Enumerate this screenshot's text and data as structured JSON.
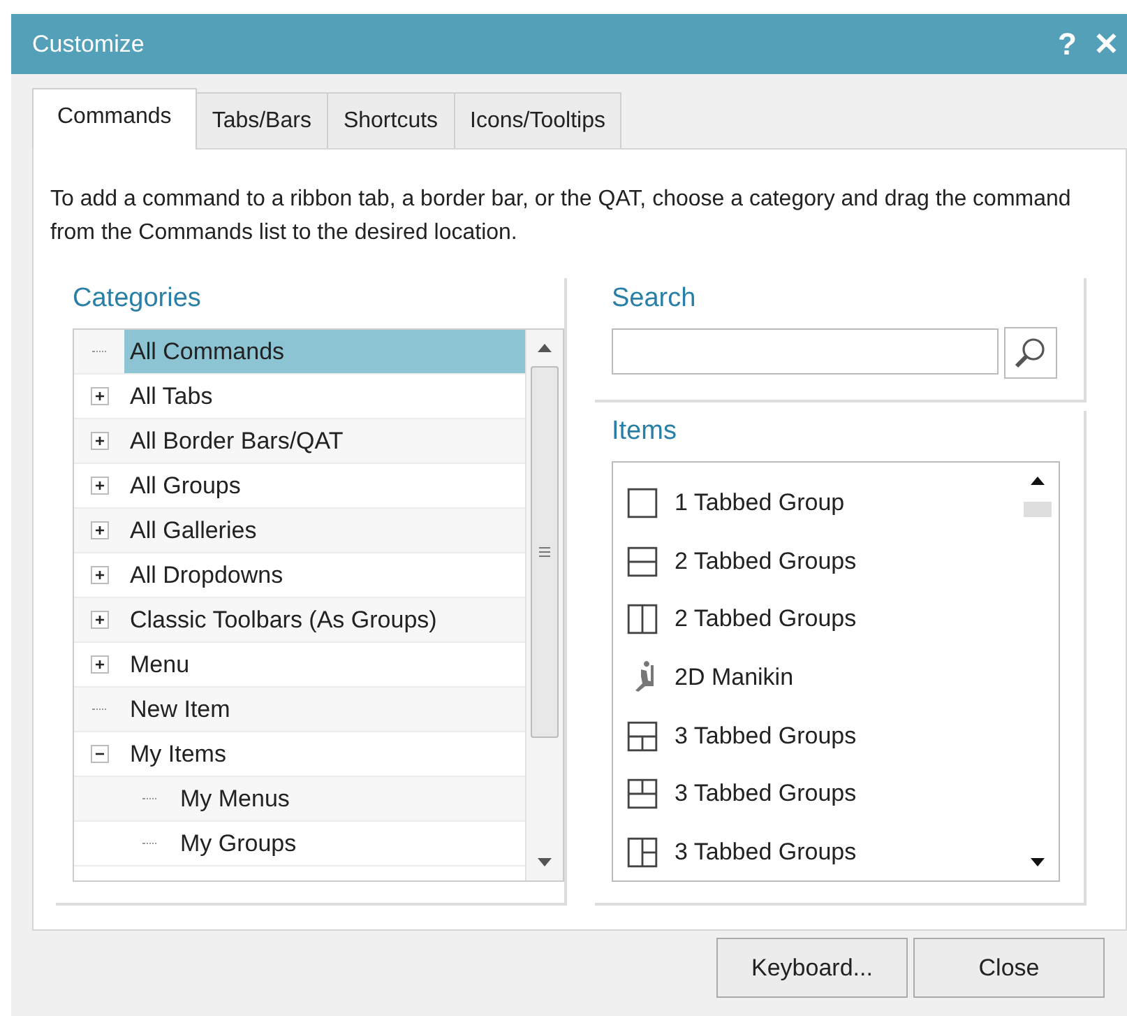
{
  "window": {
    "title": "Customize",
    "help": "?",
    "close": "✕"
  },
  "tabs": [
    {
      "label": "Commands",
      "selected": true
    },
    {
      "label": "Tabs/Bars",
      "selected": false
    },
    {
      "label": "Shortcuts",
      "selected": false
    },
    {
      "label": "Icons/Tooltips",
      "selected": false
    }
  ],
  "description": "To add a command to a ribbon tab, a border bar, or the QAT, choose a category and drag the command from the Commands list to the desired location.",
  "categories": {
    "title": "Categories",
    "items": [
      {
        "label": "All Commands",
        "selected": true
      },
      {
        "label": "All Tabs",
        "selected": false,
        "expanded": false
      },
      {
        "label": "All Border Bars/QAT",
        "selected": false,
        "expanded": false
      },
      {
        "label": "All Groups",
        "selected": false,
        "expanded": false
      },
      {
        "label": "All Galleries",
        "selected": false,
        "expanded": false
      },
      {
        "label": "All Dropdowns",
        "selected": false,
        "expanded": false
      },
      {
        "label": "Classic Toolbars (As Groups)",
        "selected": false,
        "expanded": false
      },
      {
        "label": "Menu",
        "selected": false,
        "expanded": false
      },
      {
        "label": "New Item",
        "selected": false
      },
      {
        "label": "My Items",
        "selected": false,
        "expanded": true,
        "children": [
          {
            "label": "My Menus",
            "selected": false
          },
          {
            "label": "My Groups",
            "selected": false
          }
        ]
      }
    ]
  },
  "search": {
    "title": "Search"
  },
  "items": {
    "title": "Items",
    "list": [
      {
        "label": "1 Tabbed Group",
        "kind": "layout1"
      },
      {
        "label": "2 Tabbed Groups",
        "kind": "layout2h"
      },
      {
        "label": "2 Tabbed Groups",
        "kind": "layout2v"
      },
      {
        "label": "2D Manikin",
        "kind": "manikin"
      },
      {
        "label": "3 Tabbed Groups",
        "kind": "layout3a"
      },
      {
        "label": "3 Tabbed Groups",
        "kind": "layout3b"
      },
      {
        "label": "3 Tabbed Groups",
        "kind": "layout3c"
      }
    ]
  },
  "buttons": [
    "Keyboard...",
    "Close"
  ]
}
